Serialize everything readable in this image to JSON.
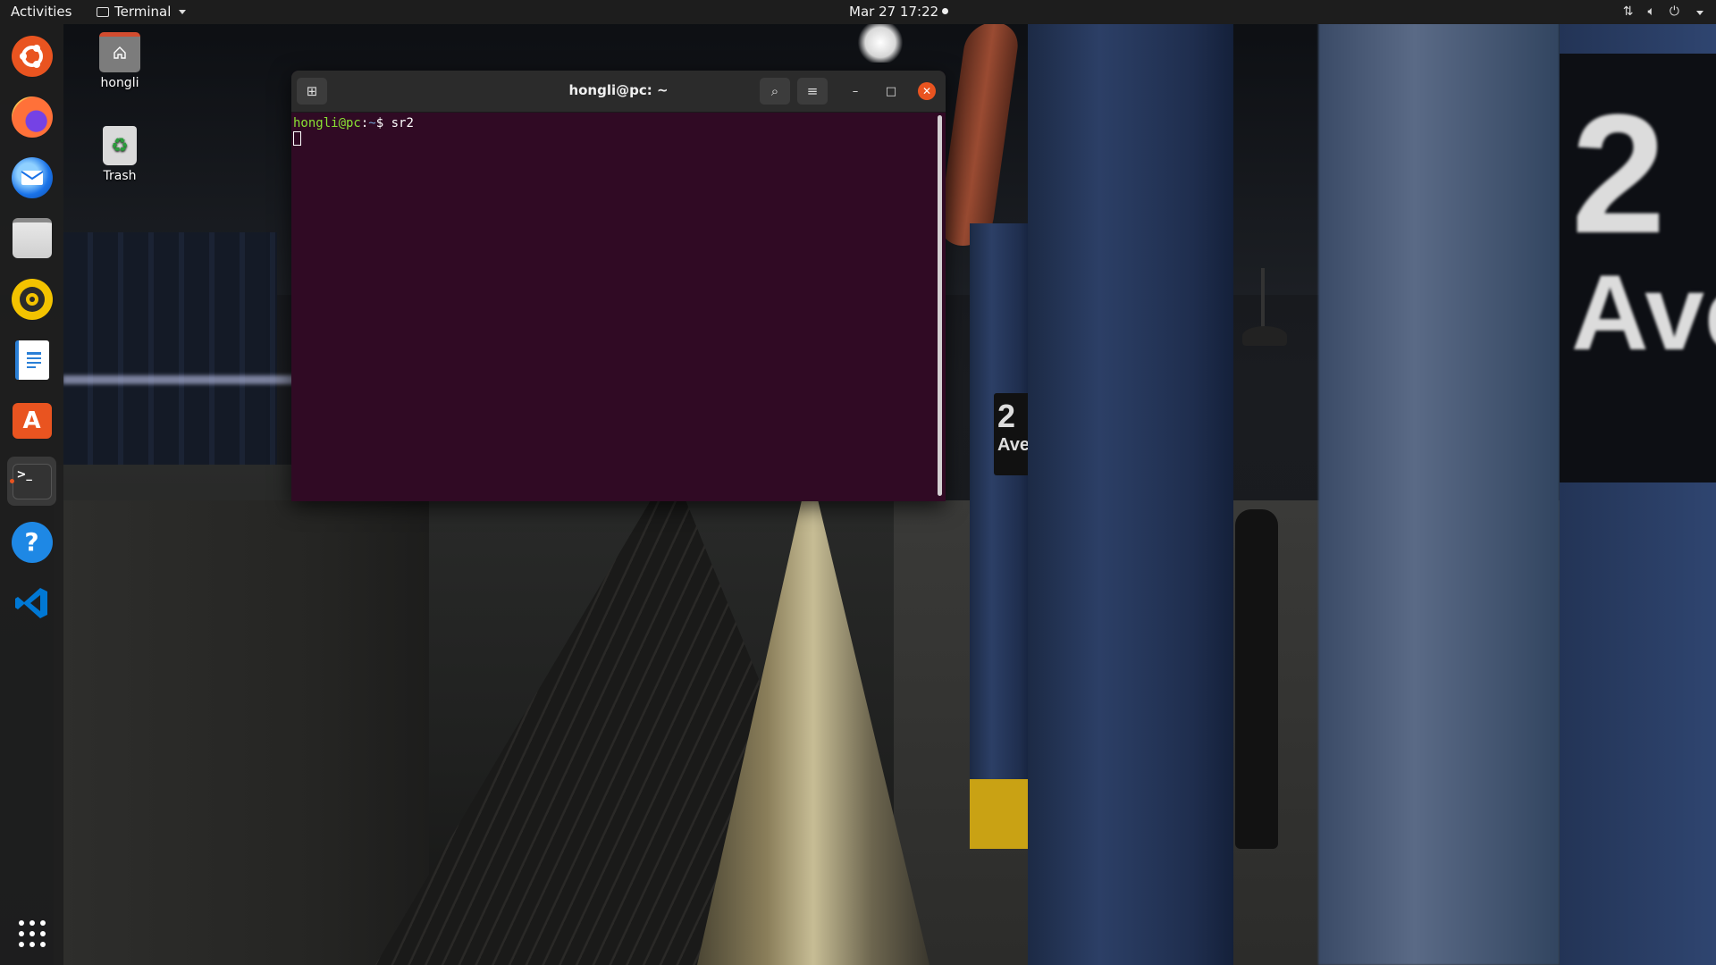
{
  "topbar": {
    "activities_label": "Activities",
    "app_name": "Terminal",
    "clock": "Mar 27  17:22",
    "tray_icons": [
      "network-icon",
      "volume-icon",
      "power-icon",
      "chevron-down-icon"
    ]
  },
  "dock": {
    "items": [
      {
        "name": "ubuntu-icon",
        "label": "Ubuntu"
      },
      {
        "name": "firefox-icon",
        "label": "Firefox"
      },
      {
        "name": "thunderbird-icon",
        "label": "Thunderbird"
      },
      {
        "name": "files-icon",
        "label": "Files"
      },
      {
        "name": "rhythmbox-icon",
        "label": "Rhythmbox"
      },
      {
        "name": "writer-icon",
        "label": "LibreOffice Writer"
      },
      {
        "name": "software-icon",
        "label": "Ubuntu Software"
      },
      {
        "name": "terminal-icon",
        "label": "Terminal"
      },
      {
        "name": "help-icon",
        "label": "Help"
      },
      {
        "name": "vscode-icon",
        "label": "Visual Studio Code"
      },
      {
        "name": "show-apps-icon",
        "label": "Show Applications"
      }
    ],
    "terminal_prompt_glyph": ">_",
    "help_glyph": "?",
    "software_glyph": "A"
  },
  "desktop": {
    "home_label": "hongli",
    "trash_label": "Trash",
    "trash_glyph": "♻"
  },
  "wallpaper": {
    "sign_number": "2",
    "sign_text": "Ave",
    "big_sign_number": "2",
    "big_sign_text": "Ave"
  },
  "terminal": {
    "title": "hongli@pc: ~",
    "prompt_user": "hongli@pc",
    "prompt_colon": ":",
    "prompt_path": "~",
    "prompt_symbol": "$",
    "command": " sr2",
    "new_tab_glyph": "⊞",
    "search_glyph": "⌕",
    "menu_glyph": "≡",
    "minimize_glyph": "–",
    "maximize_glyph": "□",
    "close_glyph": "✕"
  },
  "colors": {
    "terminal_bg": "#300a24",
    "prompt_user": "#8ae234",
    "prompt_path": "#729fcf",
    "accent": "#e95420"
  }
}
